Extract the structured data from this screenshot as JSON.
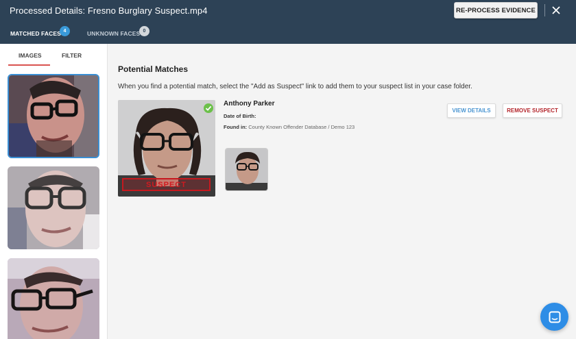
{
  "header": {
    "title": "Processed Details: Fresno Burglary Suspect.mp4",
    "reprocess_label": "RE-PROCESS EVIDENCE",
    "close_icon": "close-icon"
  },
  "tabs": [
    {
      "label": "MATCHED FACES",
      "count": "4",
      "active": true
    },
    {
      "label": "UNKNOWN FACES",
      "count": "0",
      "active": false
    }
  ],
  "left_panel": {
    "subtabs": [
      {
        "label": "IMAGES",
        "active": true
      },
      {
        "label": "FILTER",
        "active": false
      }
    ],
    "thumbnail_count_visible": 3
  },
  "main": {
    "heading": "Potential Matches",
    "instructions": "When you find a potential match, select the \"Add as Suspect\" link to add them to your suspect list in your case folder.",
    "match": {
      "name": "Anthony Parker",
      "dob_label": "Date of Birth:",
      "found_label": "Found in:",
      "found_value": "County Known Offender Database / Demo 123",
      "stamp": "SUSPECT",
      "view_details_label": "VIEW DETAILS",
      "remove_suspect_label": "REMOVE SUSPECT"
    }
  },
  "colors": {
    "header_bg": "#2d4256",
    "accent_blue": "#3a9ad9",
    "suspect_red": "#c6191f",
    "active_underline": "#d9534f",
    "check_green": "#6cc04a"
  },
  "icons": [
    "close-icon",
    "check-icon",
    "chat-icon"
  ]
}
